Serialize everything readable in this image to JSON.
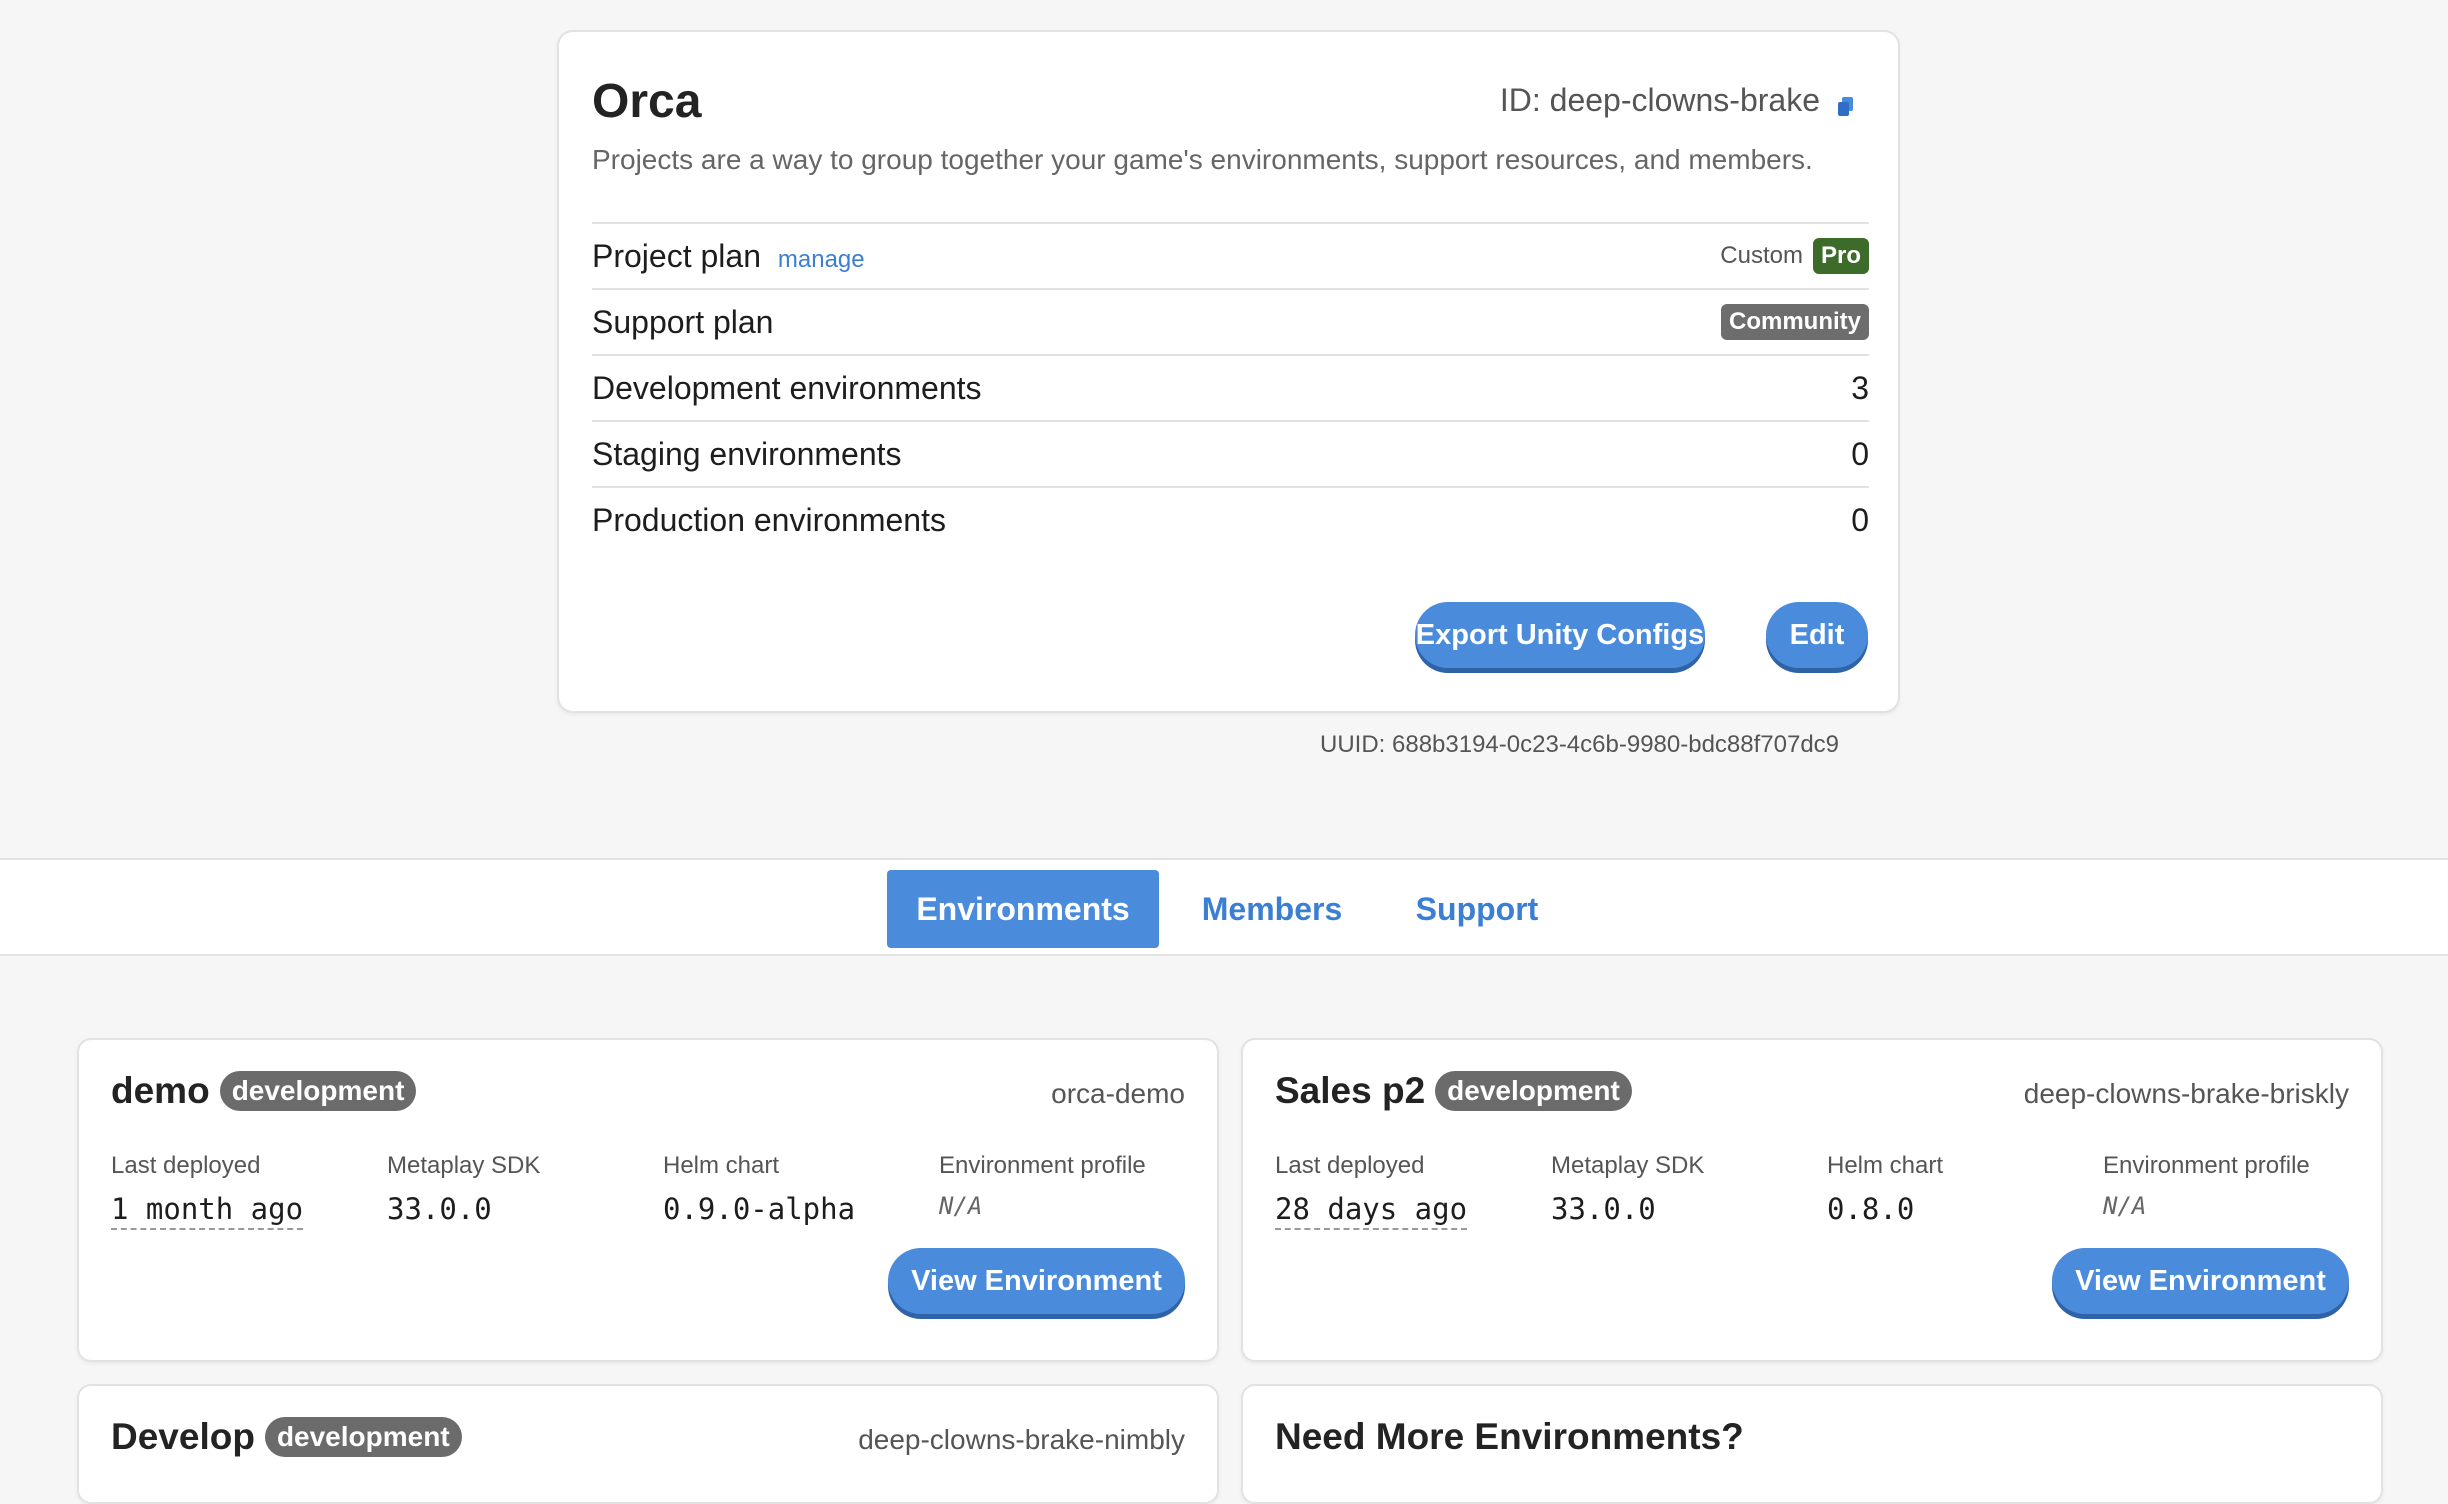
{
  "project": {
    "title": "Orca",
    "id_label": "ID: deep-clowns-brake",
    "copy_icon": "copy-icon",
    "description": "Projects are a way to group together your game's environments, support resources, and members.",
    "rows": [
      {
        "label": "Project plan",
        "link": "manage",
        "muted": "Custom",
        "badge": "Pro"
      },
      {
        "label": "Support plan",
        "badge": "Community"
      },
      {
        "label": "Development environments",
        "value": "3"
      },
      {
        "label": "Staging environments",
        "value": "0"
      },
      {
        "label": "Production environments",
        "value": "0"
      }
    ],
    "export_button": "Export Unity Configs",
    "edit_button": "Edit",
    "uuid": "UUID: 688b3194-0c23-4c6b-9980-bdc88f707dc9"
  },
  "tabs": [
    {
      "label": "Environments",
      "active": true
    },
    {
      "label": "Members",
      "active": false
    },
    {
      "label": "Support",
      "active": false
    }
  ],
  "env_meta_labels": {
    "last_deployed": "Last deployed",
    "sdk": "Metaplay SDK",
    "helm": "Helm chart",
    "profile": "Environment profile"
  },
  "environments": [
    {
      "name": "demo",
      "badge": "development",
      "slug": "orca-demo",
      "last_deployed": "1 month ago",
      "sdk": "33.0.0",
      "helm": "0.9.0-alpha",
      "profile": "N/A",
      "button": "View Environment"
    },
    {
      "name": "Sales p2",
      "badge": "development",
      "slug": "deep-clowns-brake-briskly",
      "last_deployed": "28 days ago",
      "sdk": "33.0.0",
      "helm": "0.8.0",
      "profile": "N/A",
      "button": "View Environment"
    },
    {
      "name": "Develop",
      "badge": "development",
      "slug": "deep-clowns-brake-nimbly"
    }
  ],
  "need_more": {
    "title": "Need More Environments?"
  },
  "colors": {
    "accent": "#4a8bdb",
    "pro_badge": "#3d6b2a",
    "neutral_badge": "#6b6b6b"
  }
}
